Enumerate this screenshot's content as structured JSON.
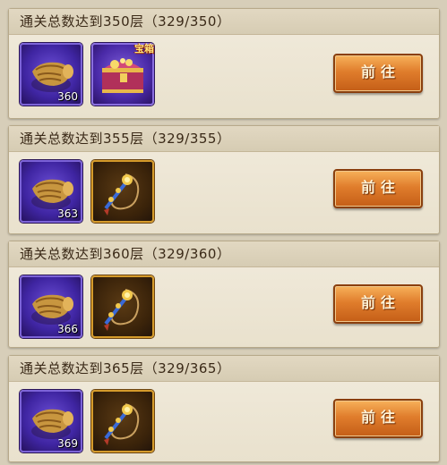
{
  "tasks": [
    {
      "title": "通关总数达到350层（329/350）",
      "reward1": {
        "icon": "wheat-sack-icon",
        "count": "360"
      },
      "reward2": {
        "icon": "treasure-chest-icon",
        "badge": "宝箱"
      },
      "button_label": "前往"
    },
    {
      "title": "通关总数达到355层（329/355）",
      "reward1": {
        "icon": "wheat-sack-icon",
        "count": "363"
      },
      "reward2": {
        "icon": "jade-pendant-icon"
      },
      "button_label": "前往"
    },
    {
      "title": "通关总数达到360层（329/360）",
      "reward1": {
        "icon": "wheat-sack-icon",
        "count": "366"
      },
      "reward2": {
        "icon": "jade-pendant-icon"
      },
      "button_label": "前往"
    },
    {
      "title": "通关总数达到365层（329/365）",
      "reward1": {
        "icon": "wheat-sack-icon",
        "count": "369"
      },
      "reward2": {
        "icon": "jade-pendant-icon"
      },
      "button_label": "前往"
    }
  ],
  "colors": {
    "card_bg": "#ede6d4",
    "header_text": "#3b2a18",
    "button_orange": "#e07d2c",
    "purple_frame": "#4a2aa8",
    "gold_frame": "#d59b2b"
  }
}
